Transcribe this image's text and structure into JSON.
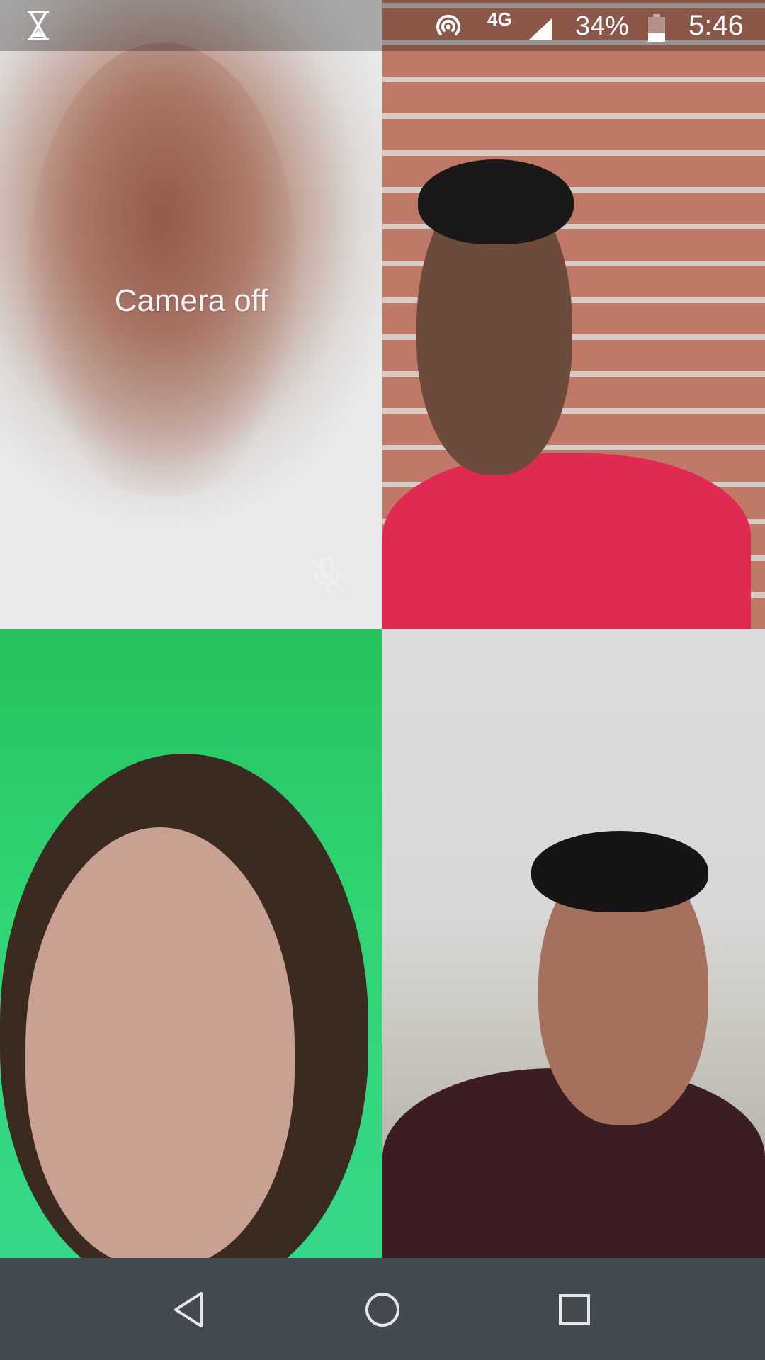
{
  "status_bar": {
    "left_icon": "hourglass-icon",
    "icons": [
      "hotspot-icon",
      "cell-signal-icon",
      "battery-icon"
    ],
    "network_type": "4G",
    "battery_percent": "34%",
    "battery_level": 0.34,
    "time": "5:46"
  },
  "video_tiles": [
    {
      "name": "participant-1",
      "camera_status": "Camera off",
      "muted": true,
      "indicator_icon": "mic-off-icon"
    },
    {
      "name": "participant-2"
    },
    {
      "name": "participant-3"
    },
    {
      "name": "participant-4"
    }
  ],
  "nav_bar": {
    "buttons": [
      "back-icon",
      "home-icon",
      "recents-icon"
    ]
  },
  "colors": {
    "nav_bar": "#434a51",
    "status_text": "#ffffff",
    "camera_off_text": "#f2f2f2",
    "tile3_background": "#2fd672"
  }
}
